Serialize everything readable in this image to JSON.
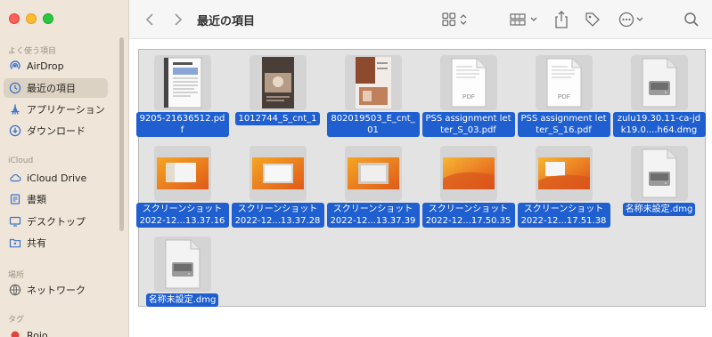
{
  "window": {
    "title": "最近の項目"
  },
  "sidebar": {
    "favorites_header": "よく使う項目",
    "favorites": [
      {
        "label": "AirDrop",
        "icon": "airdrop-icon"
      },
      {
        "label": "最近の項目",
        "icon": "clock-icon",
        "active": true
      },
      {
        "label": "アプリケーション",
        "icon": "applications-icon"
      },
      {
        "label": "ダウンロード",
        "icon": "download-icon"
      }
    ],
    "icloud_header": "iCloud",
    "icloud": [
      {
        "label": "iCloud Drive",
        "icon": "cloud-icon"
      },
      {
        "label": "書類",
        "icon": "document-icon"
      },
      {
        "label": "デスクトップ",
        "icon": "desktop-icon"
      },
      {
        "label": "共有",
        "icon": "shared-folder-icon"
      }
    ],
    "locations_header": "場所",
    "locations": [
      {
        "label": "ネットワーク",
        "icon": "network-icon"
      }
    ],
    "tags_header": "タグ",
    "tags": [
      {
        "label": "Rojo",
        "icon": "red-tag-dot-icon",
        "color": "#e0443e"
      }
    ]
  },
  "files": [
    {
      "name": "9205-21636512.pdf",
      "kind": "pdf-scan"
    },
    {
      "name": "1012744_S_cnt_1",
      "kind": "photo-dark"
    },
    {
      "name": "802019503_E_cnt_01",
      "kind": "photo-brown"
    },
    {
      "name": "PSS assignment letter_S_03.pdf",
      "kind": "pdf"
    },
    {
      "name": "PSS assignment letter_S_16.pdf",
      "kind": "pdf"
    },
    {
      "name": "zulu19.30.11-ca-jdk19.0....h64.dmg",
      "kind": "dmg"
    },
    {
      "name": "スクリーンショット 2022-12...13.37.16",
      "kind": "screenshot"
    },
    {
      "name": "スクリーンショット 2022-12...13.37.28",
      "kind": "screenshot"
    },
    {
      "name": "スクリーンショット 2022-12...13.37.39",
      "kind": "screenshot"
    },
    {
      "name": "スクリーンショット 2022-12...17.50.35",
      "kind": "screenshot"
    },
    {
      "name": "スクリーンショット 2022-12...17.51.38",
      "kind": "screenshot"
    },
    {
      "name": "名称未設定.dmg",
      "kind": "dmg"
    },
    {
      "name": "名称未設定.dmg",
      "kind": "dmg"
    }
  ],
  "colors": {
    "accent": "#1f5fd0",
    "sidebar": "#efe5d8"
  }
}
